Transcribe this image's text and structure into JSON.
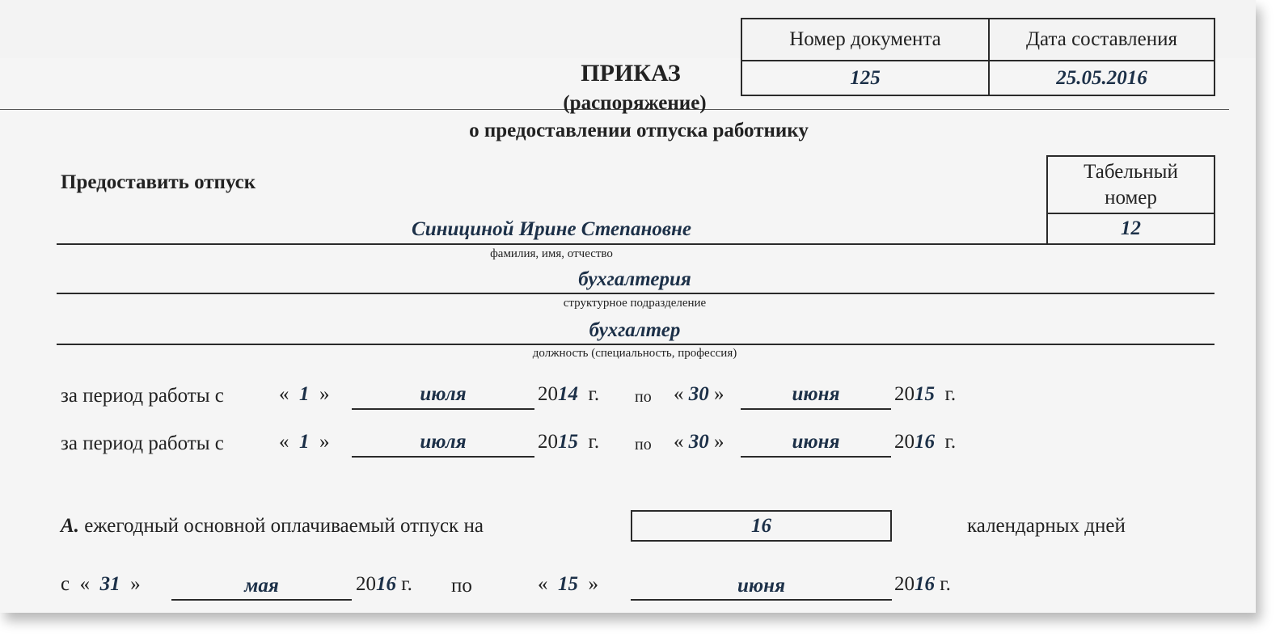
{
  "header_table": {
    "doc_number_label": "Номер документа",
    "date_label": "Дата составления",
    "doc_number": "125",
    "date": "25.05.2016"
  },
  "title": {
    "main": "ПРИКАЗ",
    "sub": "(распоряжение)",
    "subject": "о предоставлении отпуска работнику"
  },
  "grant_label": "Предоставить отпуск",
  "tab_number": {
    "label_line1": "Табельный",
    "label_line2": "номер",
    "value": "12"
  },
  "employee": {
    "name": "Синициной Ирине Степановне",
    "name_caption": "фамилия, имя, отчество",
    "department": "бухгалтерия",
    "department_caption": "структурное подразделение",
    "position": "бухгалтер",
    "position_caption": "должность (специальность, профессия)"
  },
  "periods": [
    {
      "label": "за период работы с",
      "from_day": "1",
      "from_month": "июля",
      "from_year_prefix": "20",
      "from_year_suffix": "14",
      "to_label": "по",
      "to_day": "30",
      "to_month": "июня",
      "to_year_prefix": "20",
      "to_year_suffix": "15",
      "year_unit": "г."
    },
    {
      "label": "за период работы с",
      "from_day": "1",
      "from_month": "июля",
      "from_year_prefix": "20",
      "from_year_suffix": "15",
      "to_label": "по",
      "to_day": "30",
      "to_month": "июня",
      "to_year_prefix": "20",
      "to_year_suffix": "16",
      "year_unit": "г."
    }
  ],
  "leave": {
    "letter": "А.",
    "label": "ежегодный основной оплачиваемый отпуск на",
    "days": "16",
    "days_unit": "календарных дней",
    "from_label": "с",
    "from_day": "31",
    "from_month": "мая",
    "from_year_prefix": "20",
    "from_year_suffix": "16",
    "to_label": "по",
    "to_day": "15",
    "to_month": "июня",
    "to_year_prefix": "20",
    "to_year_suffix": "16",
    "year_unit": "г."
  },
  "glyphs": {
    "quote_open": "«",
    "quote_close": "»"
  }
}
